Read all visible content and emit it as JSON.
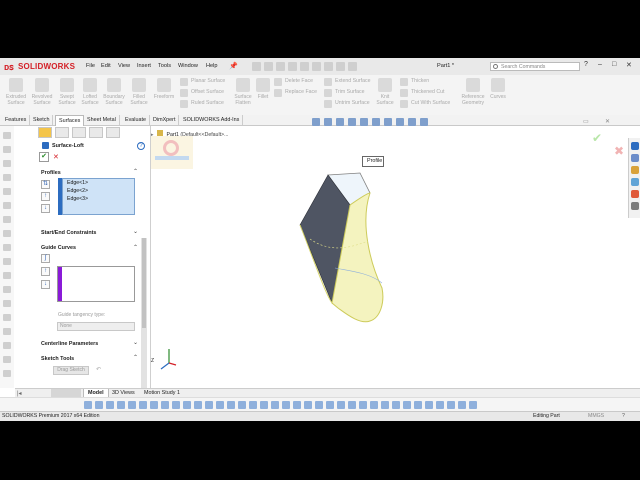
{
  "app": {
    "logo_text": "SOLIDWORKS",
    "document_title": "Part1 *",
    "search_placeholder": "Search Commands",
    "window_controls": [
      "?",
      "–",
      "□",
      "✕"
    ]
  },
  "menu": [
    "File",
    "Edit",
    "View",
    "Insert",
    "Tools",
    "Window",
    "Help"
  ],
  "ribbon": {
    "large_buttons": [
      {
        "label": "Extruded\nSurface",
        "icon": "extruded-surface-icon"
      },
      {
        "label": "Revolved\nSurface",
        "icon": "revolved-surface-icon"
      },
      {
        "label": "Swept\nSurface",
        "icon": "swept-surface-icon"
      },
      {
        "label": "Lofted\nSurface",
        "icon": "lofted-surface-icon"
      },
      {
        "label": "Boundary\nSurface",
        "icon": "boundary-surface-icon"
      },
      {
        "label": "Filled\nSurface",
        "icon": "filled-surface-icon"
      },
      {
        "label": "Freeform",
        "icon": "freeform-icon"
      }
    ],
    "group1": [
      "Planar Surface",
      "Offset Surface",
      "Ruled Surface"
    ],
    "surface_flatten": "Surface\nFlatten",
    "fillet": "Fillet",
    "group2": [
      "Delete Face",
      "Replace Face"
    ],
    "group3": [
      "Extend Surface",
      "Trim Surface",
      "Untrim Surface"
    ],
    "knit_surface": "Knit\nSurface",
    "group4": [
      "Thicken",
      "Thickened Cut",
      "Cut With Surface"
    ],
    "reference_geometry": "Reference\nGeometry",
    "curves": "Curves"
  },
  "command_tabs": [
    "Features",
    "Sketch",
    "Surfaces",
    "Sheet Metal",
    "Evaluate",
    "DimXpert",
    "SOLIDWORKS Add-Ins"
  ],
  "active_tab": "Surfaces",
  "feature_tree": {
    "root": "Part1",
    "config": "(Default<<Default>..."
  },
  "property_manager": {
    "title": "Surface-Loft",
    "help": "?",
    "ok": "✔",
    "cancel": "✕",
    "profiles": {
      "label": "Profiles",
      "items": [
        "Edge<1>",
        "Edge<2>",
        "Edge<3>"
      ]
    },
    "start_end": "Start/End Constraints",
    "guide_curves": {
      "label": "Guide Curves",
      "tangency_label": "Guide tangency type:",
      "tangency_value": "None"
    },
    "centerline": "Centerline Parameters",
    "sketch_tools": {
      "label": "Sketch Tools",
      "button": "Drag Sketch"
    }
  },
  "viewport": {
    "callout": "Profile",
    "triad_label": "Z"
  },
  "bottom_tabs": [
    "Model",
    "3D Views",
    "Motion Study 1"
  ],
  "active_bottom_tab": "Model",
  "status": {
    "left": "SOLIDWORKS Premium 2017 x64 Edition",
    "mode": "Editing Part",
    "units": "MMGS"
  },
  "colors": {
    "brand_red": "#d42027",
    "surface_fill": "#f4f3bf",
    "dark_face": "#4f5563",
    "selection_blue": "#cfe3f7",
    "guide_purple": "#8a1ad8"
  }
}
